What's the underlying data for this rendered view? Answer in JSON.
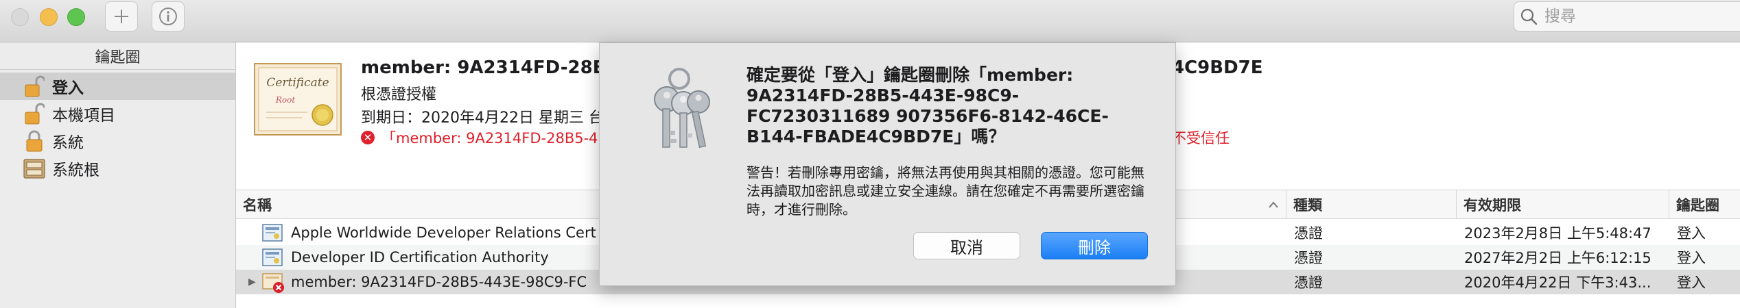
{
  "toolbar": {
    "add_symbol": "+",
    "info_symbol": "i",
    "search_placeholder": "搜尋"
  },
  "sidebar": {
    "header": "鑰匙圈",
    "items": [
      {
        "label": "登入",
        "icon": "unlocked-padlock-icon"
      },
      {
        "label": "本機項目",
        "icon": "unlocked-padlock-icon"
      },
      {
        "label": "系統",
        "icon": "locked-padlock-icon"
      },
      {
        "label": "系統根",
        "icon": "cabinet-icon"
      }
    ]
  },
  "details": {
    "title": "member: 9A2314FD-28B5-",
    "title_tail": "4C9BD7E",
    "kind": "根憑證授權",
    "expiry": "到期日：2020年4月22日 星期三 台",
    "warning": "「member: 9A2314FD-28B5-4",
    "warning_tail": "不受信任",
    "cert_script": "Certificate",
    "cert_sub": "Root"
  },
  "table": {
    "columns": {
      "name": "名稱",
      "kind": "種類",
      "expires": "有效期限",
      "keychain": "鑰匙圈"
    },
    "rows": [
      {
        "name": "Apple Worldwide Developer Relations Cert",
        "kind": "憑證",
        "expires": "2023年2月8日 上午5:48:47",
        "keychain": "登入"
      },
      {
        "name": "Developer ID Certification Authority",
        "kind": "憑證",
        "expires": "2027年2月2日 上午6:12:15",
        "keychain": "登入"
      },
      {
        "name": "member: 9A2314FD-28B5-443E-98C9-FC",
        "kind": "憑證",
        "expires": "2020年4月22日 下午3:43...",
        "keychain": "登入"
      }
    ]
  },
  "dialog": {
    "title": "確定要從「登入」鑰匙圈刪除「member: 9A2314FD-28B5-443E-98C9-FC7230311689 907356F6-8142-46CE-B144-FBADE4C9BD7E」嗎？",
    "message": "警告！若刪除專用密鑰，將無法再使用與其相關的憑證。您可能無法再讀取加密訊息或建立安全連線。請在您確定不再需要所選密鑰時，才進行刪除。",
    "cancel_label": "取消",
    "delete_label": "刪除"
  },
  "colors": {
    "accent": "#1b7ff5",
    "error": "#e0202a",
    "selection": "#d0d0d0"
  }
}
